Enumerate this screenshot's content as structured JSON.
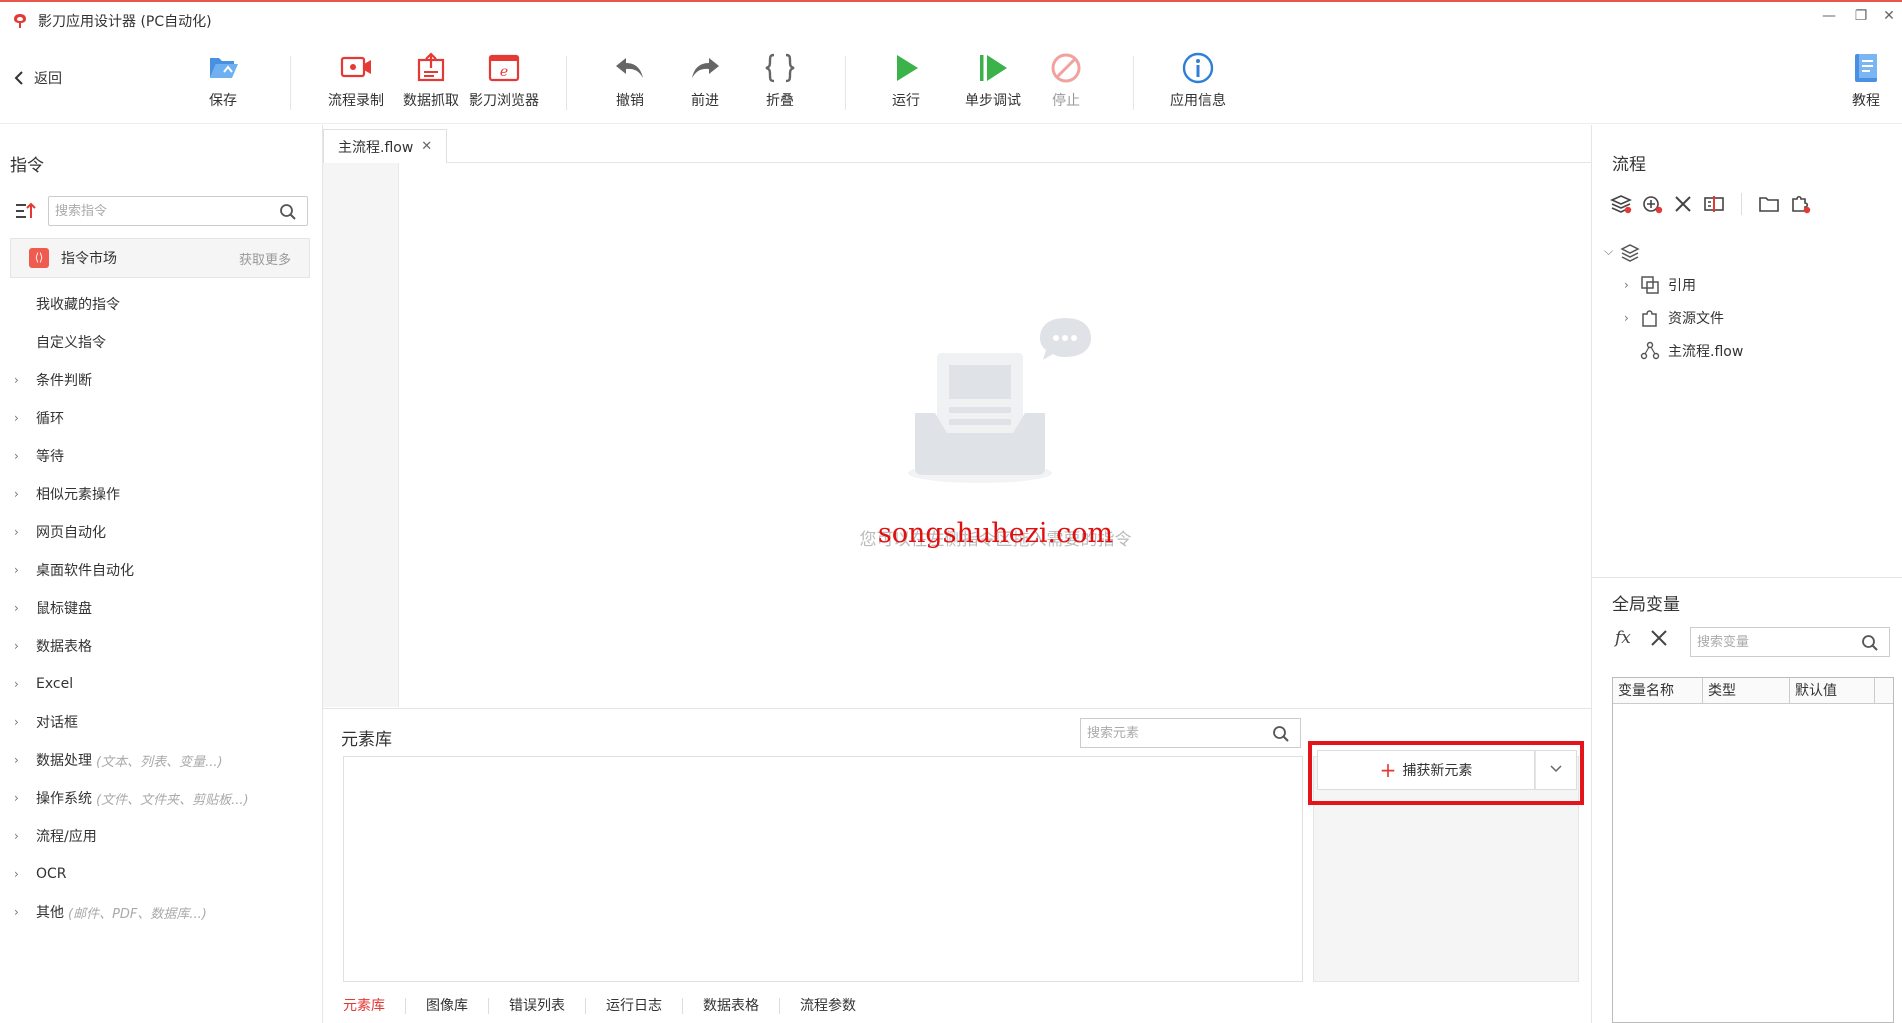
{
  "window": {
    "title": "影刀应用设计器 (PC自动化)",
    "controls": {
      "minimize": "—",
      "restore": "❐",
      "close": "✕"
    }
  },
  "toolbar": {
    "back_label": "返回",
    "save": "保存",
    "record": "流程录制",
    "grab": "数据抓取",
    "browser": "影刀浏览器",
    "undo": "撤销",
    "redo": "前进",
    "fold": "折叠",
    "run": "运行",
    "step_debug": "单步调试",
    "stop": "停止",
    "app_info": "应用信息",
    "tutorial": "教程"
  },
  "commands": {
    "title": "指令",
    "search_placeholder": "搜索指令",
    "market_label": "指令市场",
    "market_more": "获取更多",
    "items": [
      {
        "label": "我收藏的指令",
        "hint": "",
        "expandable": false
      },
      {
        "label": "自定义指令",
        "hint": "",
        "expandable": false
      },
      {
        "label": "条件判断",
        "hint": "",
        "expandable": true
      },
      {
        "label": "循环",
        "hint": "",
        "expandable": true
      },
      {
        "label": "等待",
        "hint": "",
        "expandable": true
      },
      {
        "label": "相似元素操作",
        "hint": "",
        "expandable": true
      },
      {
        "label": "网页自动化",
        "hint": "",
        "expandable": true
      },
      {
        "label": "桌面软件自动化",
        "hint": "",
        "expandable": true
      },
      {
        "label": "鼠标键盘",
        "hint": "",
        "expandable": true
      },
      {
        "label": "数据表格",
        "hint": "",
        "expandable": true
      },
      {
        "label": "Excel",
        "hint": "",
        "expandable": true
      },
      {
        "label": "对话框",
        "hint": "",
        "expandable": true
      },
      {
        "label": "数据处理",
        "hint": "(文本、列表、变量...)",
        "expandable": true
      },
      {
        "label": "操作系统",
        "hint": "(文件、文件夹、剪贴板...)",
        "expandable": true
      },
      {
        "label": "流程/应用",
        "hint": "",
        "expandable": true
      },
      {
        "label": "OCR",
        "hint": "",
        "expandable": true
      },
      {
        "label": "其他",
        "hint": "(邮件、PDF、数据库...)",
        "expandable": true
      }
    ]
  },
  "editor": {
    "tab_label": "主流程.flow",
    "tab_close": "✕",
    "empty_text": "您可以在左侧指令区拖入需要的指令",
    "watermark": "songshuhezi.com"
  },
  "element_library": {
    "title": "元素库",
    "search_placeholder": "搜索元素",
    "capture_label": "捕获新元素",
    "bottom_tabs": [
      "元素库",
      "图像库",
      "错误列表",
      "运行日志",
      "数据表格",
      "流程参数"
    ],
    "active_tab": 0
  },
  "flow_panel": {
    "title": "流程",
    "tree": {
      "ref": "引用",
      "resources": "资源文件",
      "main_flow": "主流程.flow"
    }
  },
  "global_vars": {
    "title": "全局变量",
    "fx_label": "fx",
    "search_placeholder": "搜索变量",
    "columns": [
      "变量名称",
      "类型",
      "默认值"
    ]
  },
  "colors": {
    "accent": "#e53935",
    "run_green": "#3cb34a",
    "info_blue": "#2f7fd8",
    "highlight_red": "#e3151b"
  }
}
